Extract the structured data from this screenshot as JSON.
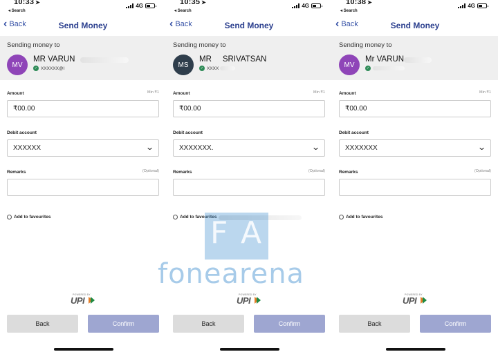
{
  "screens": [
    {
      "status": {
        "time": "10:33",
        "network": "4G",
        "back_app": "◂ Search"
      },
      "nav": {
        "back": "Back",
        "title": "Send Money"
      },
      "recipient": {
        "label": "Sending money to",
        "initials": "MV",
        "avatar_color": "#8f45b8",
        "name": "MR VARUN",
        "upi_id": "XXXXXX@l"
      },
      "amount": {
        "label": "Amount",
        "aux": "Min ₹1",
        "value": "₹00.00"
      },
      "debit": {
        "label": "Debit account",
        "value": "XXXXXX"
      },
      "remarks": {
        "label": "Remarks",
        "aux": "(Optional)",
        "value": ""
      },
      "favourites": "Add to favourites",
      "upi_logo": {
        "powered": "POWERED BY",
        "text": "UPI"
      },
      "buttons": {
        "back": "Back",
        "confirm": "Confirm"
      }
    },
    {
      "status": {
        "time": "10:35",
        "network": "4G",
        "back_app": "◂ Search"
      },
      "nav": {
        "back": "Back",
        "title": "Send Money"
      },
      "recipient": {
        "label": "Sending money to",
        "initials": "MS",
        "avatar_color": "#2f3e4c",
        "name": "MR     SRIVATSAN",
        "upi_id": "XXXX"
      },
      "amount": {
        "label": "Amount",
        "aux": "Min ₹1",
        "value": "₹00.00"
      },
      "debit": {
        "label": "Debit account",
        "value": "XXXXXXX."
      },
      "remarks": {
        "label": "Remarks",
        "aux": "(Optional)",
        "value": ""
      },
      "favourites": "Add to favourites",
      "upi_logo": {
        "powered": "POWERED BY",
        "text": "UPI"
      },
      "buttons": {
        "back": "Back",
        "confirm": "Confirm"
      }
    },
    {
      "status": {
        "time": "10:38",
        "network": "4G",
        "back_app": "◂ Search"
      },
      "nav": {
        "back": "Back",
        "title": "Send Money"
      },
      "recipient": {
        "label": "Sending money to",
        "initials": "MV",
        "avatar_color": "#8f45b8",
        "name": "Mr VARUN",
        "upi_id": ""
      },
      "amount": {
        "label": "Amount",
        "aux": "Min ₹1",
        "value": "₹00.00"
      },
      "debit": {
        "label": "Debit account",
        "value": "XXXXXXX"
      },
      "remarks": {
        "label": "Remarks",
        "aux": "(Optional)",
        "value": ""
      },
      "favourites": "Add to favourites",
      "upi_logo": {
        "powered": "POWERED BY",
        "text": "UPI"
      },
      "buttons": {
        "back": "Back",
        "confirm": "Confirm"
      }
    }
  ],
  "watermark": {
    "letter_1": "F",
    "letter_2": "A",
    "word": "fonearena"
  },
  "colors": {
    "accent": "#2b3f8e",
    "confirm": "#9ea6d1",
    "watermark": "#3c8ccd"
  },
  "icons": [
    "back-chevron-icon",
    "signal-icon",
    "battery-icon",
    "dropdown-chevron-icon",
    "radio-icon",
    "upi-verified-icon",
    "location-arrow-icon"
  ]
}
